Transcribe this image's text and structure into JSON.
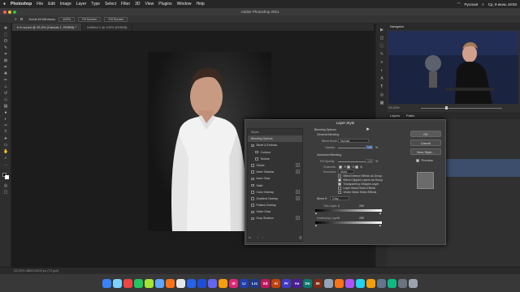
{
  "menubar": {
    "items": [
      "Photoshop",
      "File",
      "Edit",
      "Image",
      "Layer",
      "Type",
      "Select",
      "Filter",
      "3D",
      "View",
      "Plugins",
      "Window",
      "Help"
    ],
    "right": [
      "Русская",
      "Ср, 9 июнь 19:50"
    ]
  },
  "window": {
    "title": "Adobe Photoshop 2021"
  },
  "options": {
    "scroll_all": "Scroll All Windows",
    "zoom": "100%",
    "fit": "Fit Screen",
    "fill": "Fill Screen"
  },
  "tabs": [
    {
      "label": "b in w.psd @ 33,3% (Canvas 1, RGB/8) *"
    },
    {
      "label": "Untitled-1 @ 100% (RGB/8)"
    }
  ],
  "navigator": {
    "title": "Navigator",
    "zoom": "33,33%"
  },
  "layers_panel": {
    "tabs": [
      "Layers",
      "Paths"
    ]
  },
  "status": {
    "text": "33,33%   4800×3200 px (72 ppi)"
  },
  "dialog": {
    "title": "Layer Style",
    "styles_header": "Styles",
    "styles": [
      {
        "label": "Blending Options",
        "selected": true,
        "check": false,
        "plus": false
      },
      {
        "label": "Bevel & Emboss",
        "check": true,
        "plus": false
      },
      {
        "label": "Contour",
        "check": true,
        "plus": false,
        "indent": true
      },
      {
        "label": "Texture",
        "check": true,
        "plus": false,
        "indent": true
      },
      {
        "label": "Stroke",
        "check": true,
        "plus": true
      },
      {
        "label": "Inner Shadow",
        "check": true,
        "plus": true
      },
      {
        "label": "Inner Glow",
        "check": true,
        "plus": false
      },
      {
        "label": "Satin",
        "check": true,
        "plus": false
      },
      {
        "label": "Color Overlay",
        "check": true,
        "plus": true
      },
      {
        "label": "Gradient Overlay",
        "check": true,
        "plus": true
      },
      {
        "label": "Pattern Overlay",
        "check": true,
        "plus": false
      },
      {
        "label": "Outer Glow",
        "check": true,
        "plus": false
      },
      {
        "label": "Drop Shadow",
        "check": true,
        "plus": true
      }
    ],
    "blending": {
      "header": "Blending Options",
      "general": "General Blending",
      "blend_mode_label": "Blend Mode:",
      "blend_mode_value": "Normal",
      "opacity_label": "Opacity:",
      "opacity_value": "100",
      "percent": "%",
      "advanced": "Advanced Blending",
      "fill_label": "Fill Opacity:",
      "fill_value": "100",
      "channels_label": "Channels:",
      "channels": [
        "R",
        "G",
        "B"
      ],
      "knockout_label": "Knockout:",
      "knockout_value": "None",
      "checks": [
        "Blend Interior Effects as Group",
        "Blend Clipped Layers as Group",
        "Transparency Shapes Layer",
        "Layer Mask Hides Effects",
        "Vector Mask Hides Effects"
      ],
      "blend_if_label": "Blend If:",
      "blend_if_value": "Gray",
      "this_layer_label": "This Layer:",
      "this_layer_lo": "0",
      "this_layer_hi": "255",
      "underlying_label": "Underlying Layer:",
      "underlying_lo": "0",
      "underlying_hi": "255"
    },
    "buttons": {
      "ok": "OK",
      "cancel": "Cancel",
      "new_style": "New Style...",
      "preview": "Preview"
    }
  },
  "dock": [
    {
      "t": "",
      "c": "#3b82f6"
    },
    {
      "t": "",
      "c": "#7dd3fc"
    },
    {
      "t": "",
      "c": "#ef4444"
    },
    {
      "t": "",
      "c": "#22c55e"
    },
    {
      "t": "",
      "c": "#a3e635"
    },
    {
      "t": "",
      "c": "#60a5fa"
    },
    {
      "t": "",
      "c": "#f97316"
    },
    {
      "t": "",
      "c": "#e5e7eb"
    },
    {
      "t": "",
      "c": "#2563eb"
    },
    {
      "t": "",
      "c": "#1d4ed8"
    },
    {
      "t": "",
      "c": "#6366f1"
    },
    {
      "t": "",
      "c": "#f59e0b"
    },
    {
      "t": "Id",
      "c": "#db2777"
    },
    {
      "t": "Lr",
      "c": "#1e40af"
    },
    {
      "t": "Lrc",
      "c": "#1e3a8a"
    },
    {
      "t": "Xd",
      "c": "#be185d"
    },
    {
      "t": "Ai",
      "c": "#c2410c"
    },
    {
      "t": "Pr",
      "c": "#4338ca"
    },
    {
      "t": "Ae",
      "c": "#4c1d95"
    },
    {
      "t": "Dn",
      "c": "#0f766e"
    },
    {
      "t": "Br",
      "c": "#7c2d12"
    },
    {
      "t": "",
      "c": "#94a3b8"
    },
    {
      "t": "",
      "c": "#f97316"
    },
    {
      "t": "",
      "c": "#a855f7"
    },
    {
      "t": "",
      "c": "#22d3ee"
    },
    {
      "t": "",
      "c": "#f59e0b"
    },
    {
      "t": "",
      "c": "#64748b"
    },
    {
      "t": "",
      "c": "#10b981"
    },
    {
      "t": "",
      "c": "#6b7280"
    },
    {
      "t": "",
      "c": "#9ca3af"
    }
  ],
  "colors": {
    "accent": "#4c7fd6",
    "photo_bg": "#151515",
    "selection": "#3c4e6c"
  }
}
